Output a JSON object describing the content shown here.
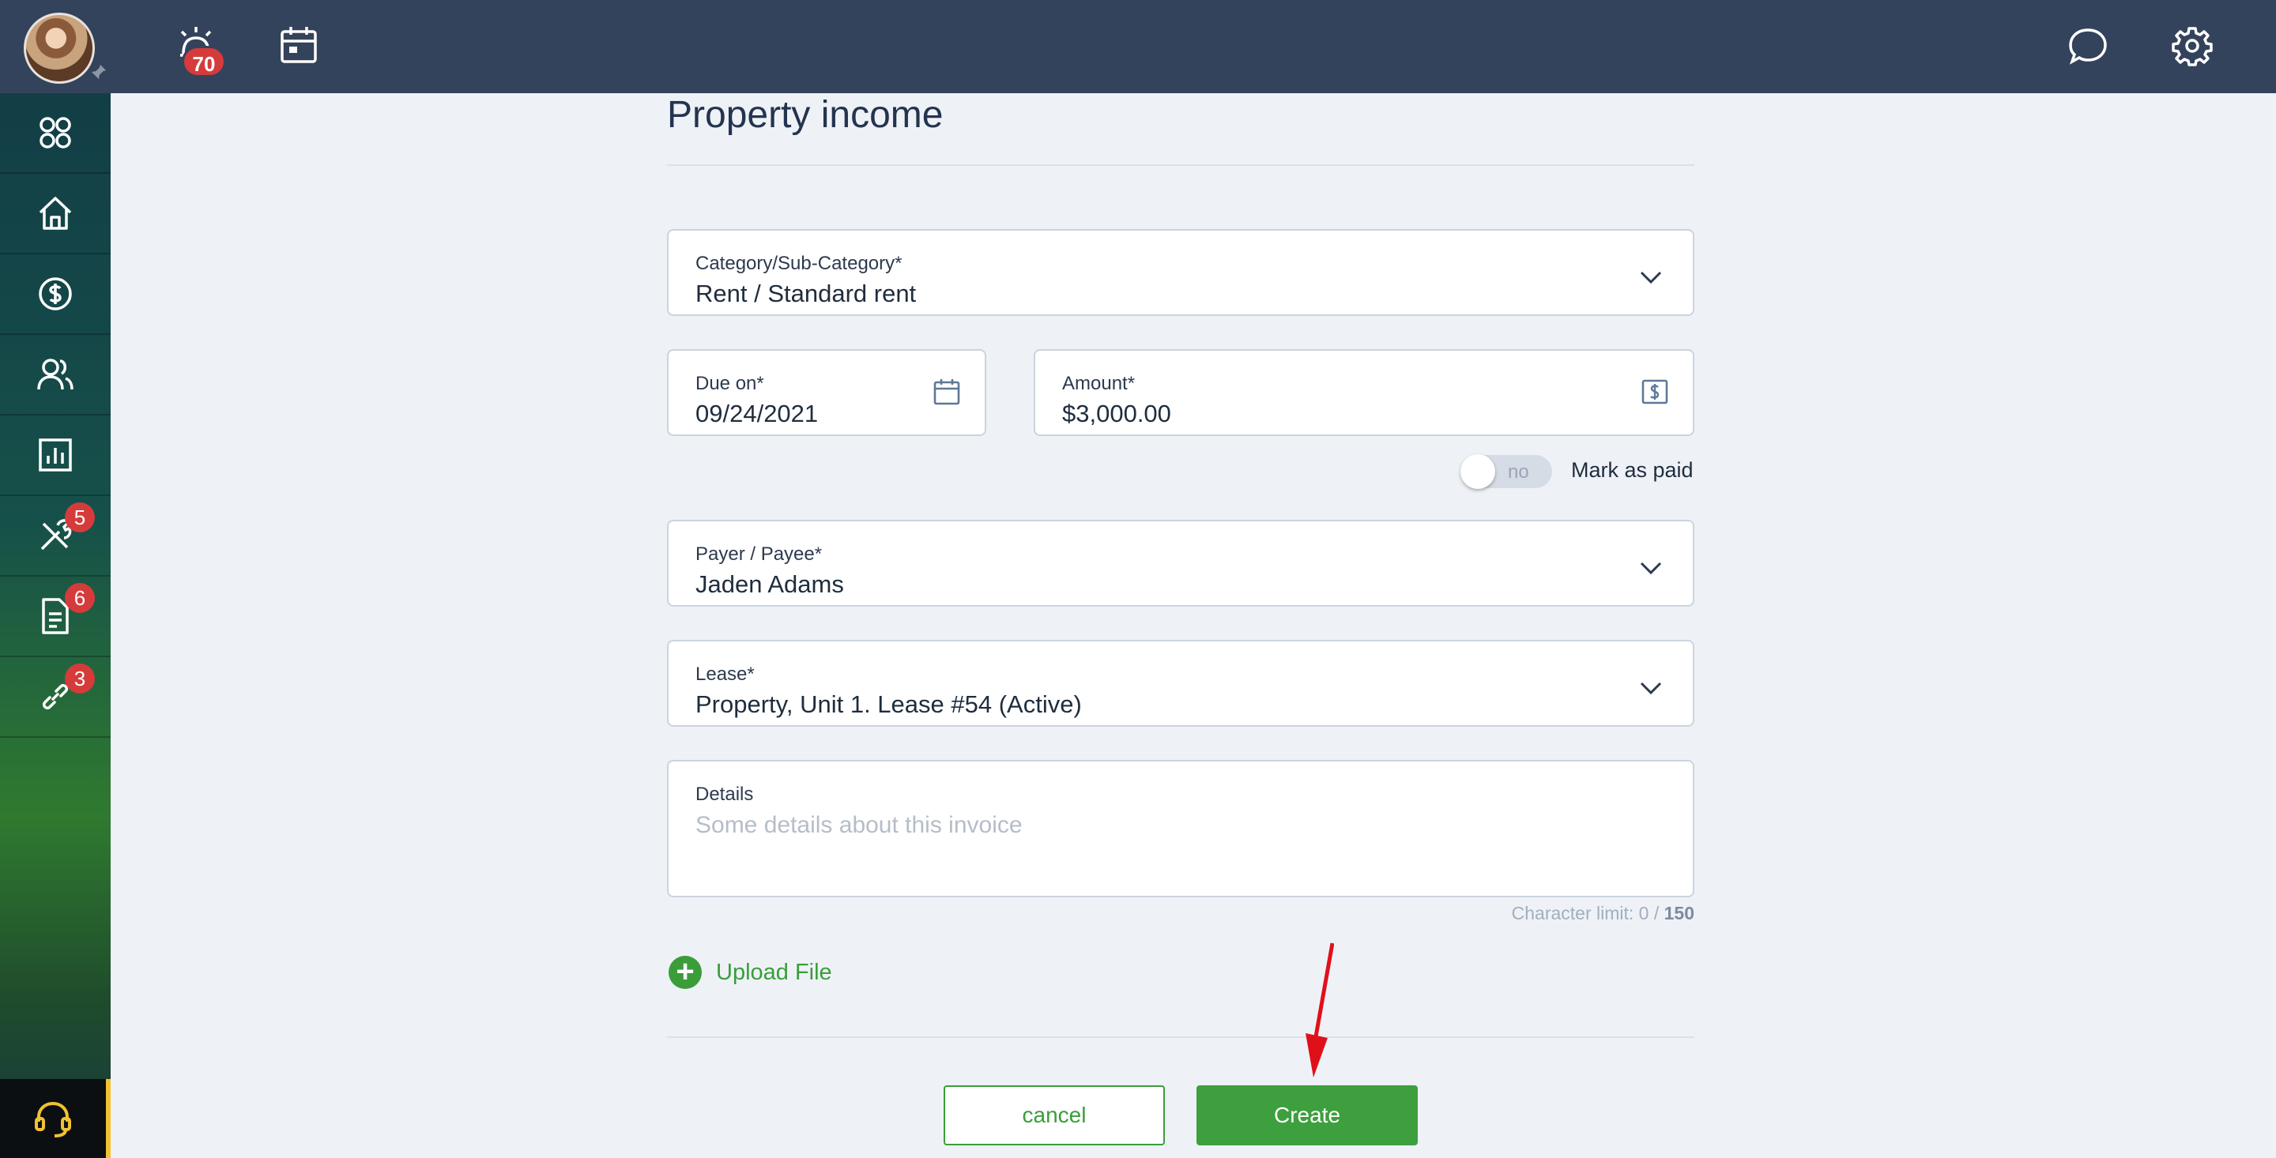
{
  "header": {
    "notifications_count": "70",
    "icons": [
      "alarm-icon",
      "calendar-icon",
      "chat-icon",
      "gear-icon"
    ]
  },
  "sidebar": {
    "items": [
      {
        "name": "dashboard",
        "icon": "grid-icon",
        "badge": ""
      },
      {
        "name": "home",
        "icon": "home-icon",
        "badge": ""
      },
      {
        "name": "accounting",
        "icon": "dollar-icon",
        "badge": ""
      },
      {
        "name": "people",
        "icon": "people-icon",
        "badge": ""
      },
      {
        "name": "reports",
        "icon": "chart-icon",
        "badge": ""
      },
      {
        "name": "maintenance",
        "icon": "tools-icon",
        "badge": "5"
      },
      {
        "name": "documents",
        "icon": "document-icon",
        "badge": "6"
      },
      {
        "name": "links",
        "icon": "link-icon",
        "badge": "3"
      }
    ],
    "support_icon": "headset-icon"
  },
  "form": {
    "title": "Property income",
    "category": {
      "label": "Category/Sub-Category*",
      "value": "Rent / Standard rent"
    },
    "due_on": {
      "label": "Due on*",
      "value": "09/24/2021"
    },
    "amount": {
      "label": "Amount*",
      "value": "$3,000.00"
    },
    "mark_paid": {
      "toggle_text": "no",
      "label": "Mark as paid"
    },
    "payer": {
      "label": "Payer / Payee*",
      "value": "Jaden Adams"
    },
    "lease": {
      "label": "Lease*",
      "value": "Property, Unit 1. Lease #54 (Active)"
    },
    "details": {
      "label": "Details",
      "placeholder": "Some details about this invoice"
    },
    "char_limit_prefix": "Character limit: 0 / ",
    "char_limit_max": "150",
    "upload_label": "Upload File",
    "cancel_label": "cancel",
    "create_label": "Create"
  },
  "colors": {
    "topbar": "#34435c",
    "accent_green": "#3d9f3d",
    "badge_red": "#d63b3b",
    "annotation_arrow": "#e0101b"
  }
}
